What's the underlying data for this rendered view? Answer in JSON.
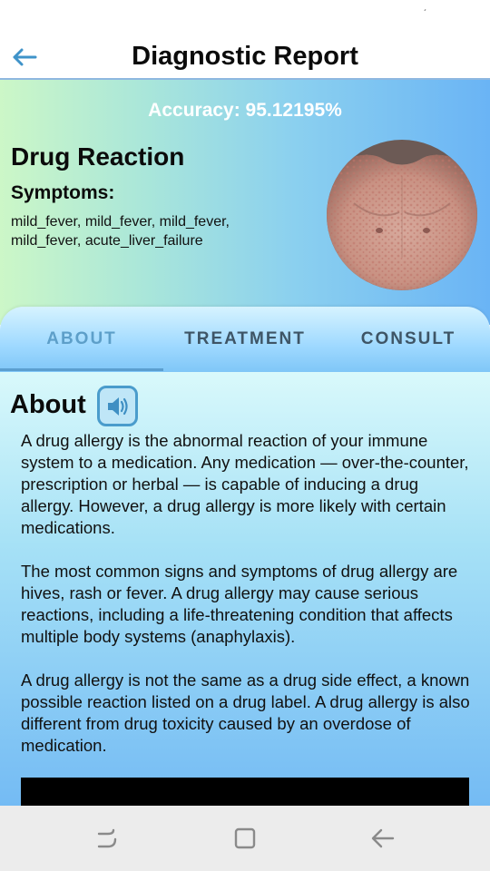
{
  "app": {
    "title": "Diagnostic Report"
  },
  "result": {
    "accuracy": "Accuracy: 95.12195%",
    "disease": "Drug Reaction",
    "symptoms_label": "Symptoms:",
    "symptoms": "mild_fever, mild_fever, mild_fever, mild_fever, acute_liver_failure"
  },
  "tabs": [
    {
      "label": "ABOUT",
      "active": true
    },
    {
      "label": "TREATMENT",
      "active": false
    },
    {
      "label": "CONSULT",
      "active": false
    }
  ],
  "about": {
    "title": "About",
    "paragraphs": [
      "A drug allergy is the abnormal reaction of your immune system to a medication. Any medication — over-the-counter, prescription or herbal — is capable of inducing a drug allergy. However, a drug allergy is more likely with certain medications.",
      "The most common signs and symptoms of drug allergy are hives, rash or fever. A drug allergy may cause serious reactions, including a life-threatening condition that affects multiple body systems (anaphylaxis).",
      "A drug allergy is not the same as a drug side effect, a known possible reaction listed on a drug label. A drug allergy is also different from drug toxicity caused by an overdose of medication."
    ]
  },
  "icons": {
    "back": "arrow-left-icon",
    "speaker": "speaker-icon",
    "nav_recents": "recents-icon",
    "nav_home": "home-icon",
    "nav_back": "back-icon"
  },
  "colors": {
    "accent": "#4a9ccc",
    "tab_active": "#5d9fc9",
    "tab_inactive": "#3e5566"
  }
}
